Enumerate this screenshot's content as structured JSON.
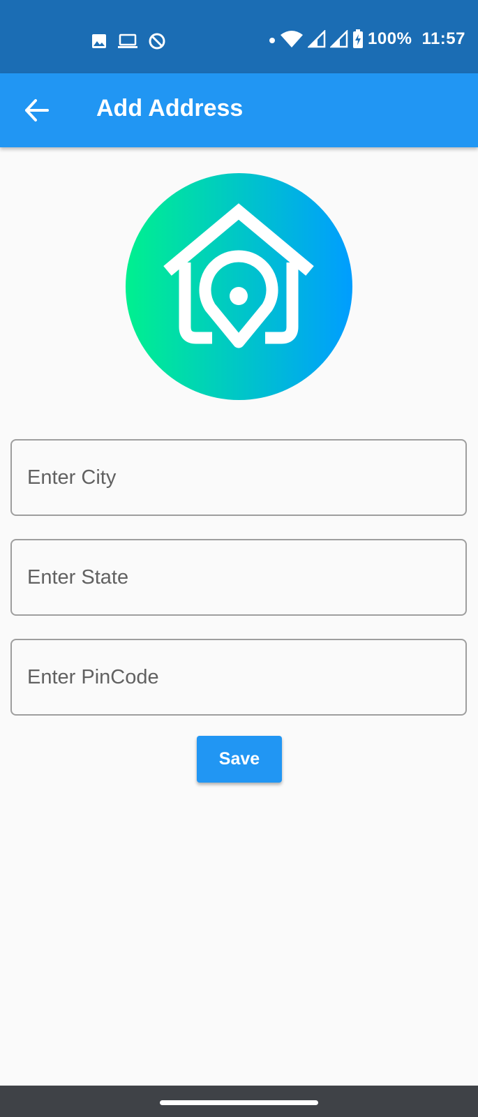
{
  "status_bar": {
    "battery": "100%",
    "time": "11:57",
    "icons": [
      "image-icon",
      "laptop-icon",
      "data-saver-icon",
      "dot-icon",
      "wifi-icon",
      "signal-icon",
      "signal-icon",
      "battery-charging-icon"
    ]
  },
  "app_bar": {
    "title": "Add Address",
    "back_icon": "arrow-back-icon"
  },
  "logo": {
    "icon": "home-location-icon",
    "gradient": [
      "#00f08f",
      "#009dff"
    ]
  },
  "form": {
    "city": {
      "placeholder": "Enter City",
      "value": ""
    },
    "state": {
      "placeholder": "Enter State",
      "value": ""
    },
    "pincode": {
      "placeholder": "Enter PinCode",
      "value": ""
    },
    "save_label": "Save"
  },
  "colors": {
    "status_bar": "#1b6db4",
    "primary": "#2196f3",
    "background": "#fafafa",
    "nav_bar": "#3f4247"
  }
}
